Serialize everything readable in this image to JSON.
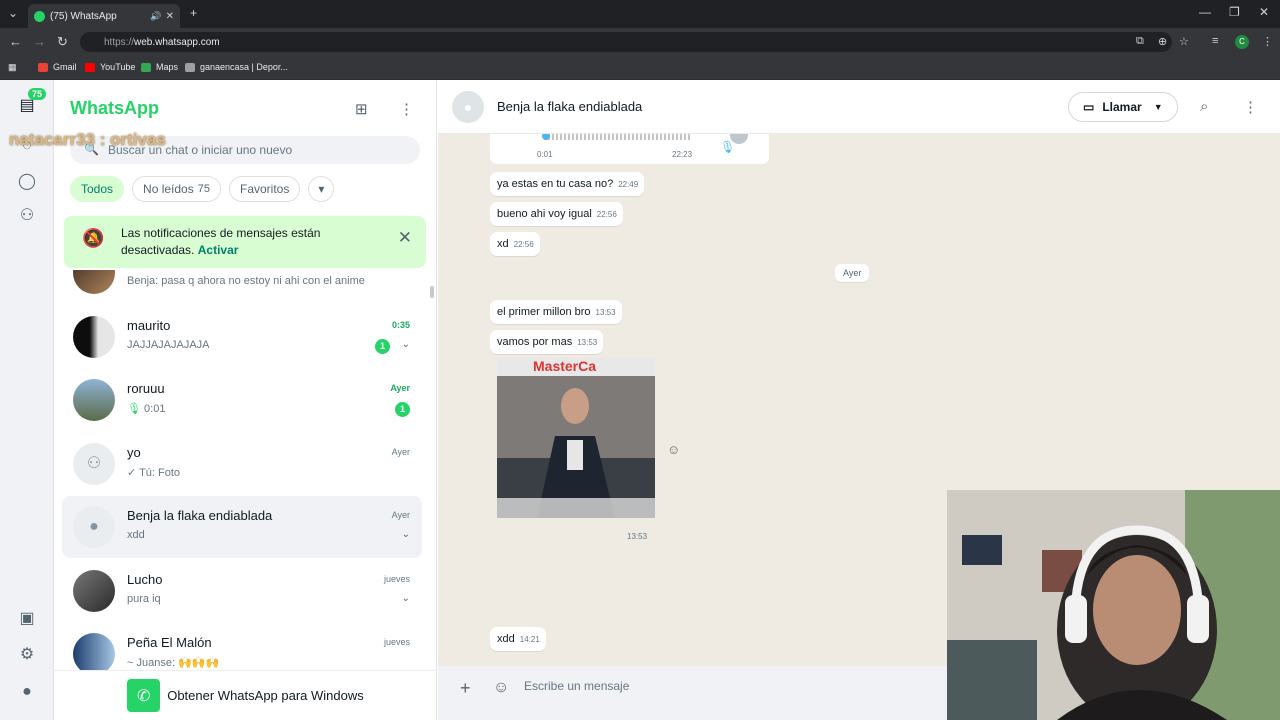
{
  "browser": {
    "tab_title": "(75) WhatsApp",
    "url_prefix": "https://",
    "url_domain": "web.whatsapp.com",
    "profile_initial": "C",
    "bookmarks": [
      "Gmail",
      "YouTube",
      "Maps",
      "ganaencasa | Depor..."
    ]
  },
  "rail": {
    "unread_badge": "75"
  },
  "overlay_text": "natacarr33 : ortivas",
  "sidebar": {
    "title": "WhatsApp",
    "search_placeholder": "Buscar un chat o iniciar uno nuevo",
    "filters": [
      {
        "label": "Todos",
        "count": ""
      },
      {
        "label": "No leídos",
        "count": "75"
      },
      {
        "label": "Favoritos",
        "count": ""
      }
    ],
    "notification": {
      "text": "Las notificaciones de mensajes están desactivadas.",
      "action": "Activar"
    },
    "chats": [
      {
        "name": "",
        "preview": "Benja: pasa q ahora no estoy ni ahi con el anime",
        "time": "",
        "unread": ""
      },
      {
        "name": "maurito",
        "preview": "JAJJAJAJAJAJA",
        "time": "0:35",
        "unread": "1"
      },
      {
        "name": "roruuu",
        "preview": "0:01",
        "time": "Ayer",
        "unread": "1"
      },
      {
        "name": "yo",
        "preview": "Tú:  Foto",
        "time": "Ayer",
        "unread": ""
      },
      {
        "name": "Benja la flaka endiablada",
        "preview": "xdd",
        "time": "Ayer",
        "unread": ""
      },
      {
        "name": "Lucho",
        "preview": "pura iq",
        "time": "jueves",
        "unread": ""
      },
      {
        "name": "Peña El Malón",
        "preview": "~ Juanse: 🙌🙌🙌",
        "time": "jueves",
        "unread": ""
      }
    ],
    "get_windows": "Obtener WhatsApp para Windows"
  },
  "conversation": {
    "contact_name": "Benja la flaka endiablada",
    "call_label": "Llamar",
    "voice_note": {
      "elapsed": "0:01",
      "time": "22:23"
    },
    "messages": [
      {
        "text": "ya estas en tu casa no?",
        "time": "22:49"
      },
      {
        "text": "bueno ahi voy igual",
        "time": "22:56"
      },
      {
        "text": "xd",
        "time": "22:56"
      },
      {
        "text": "el primer millon bro",
        "time": "13:53"
      },
      {
        "text": "vamos por mas",
        "time": "13:53"
      },
      {
        "text": "xdd",
        "time": "14:21"
      }
    ],
    "day_separator": "Ayer",
    "image_time": "13:53",
    "image_overlay_text": "MasterCa",
    "composer_placeholder": "Escribe un mensaje"
  },
  "colors": {
    "brand": "#25d366",
    "accent": "#008069",
    "chat_bg": "#efeae2"
  }
}
